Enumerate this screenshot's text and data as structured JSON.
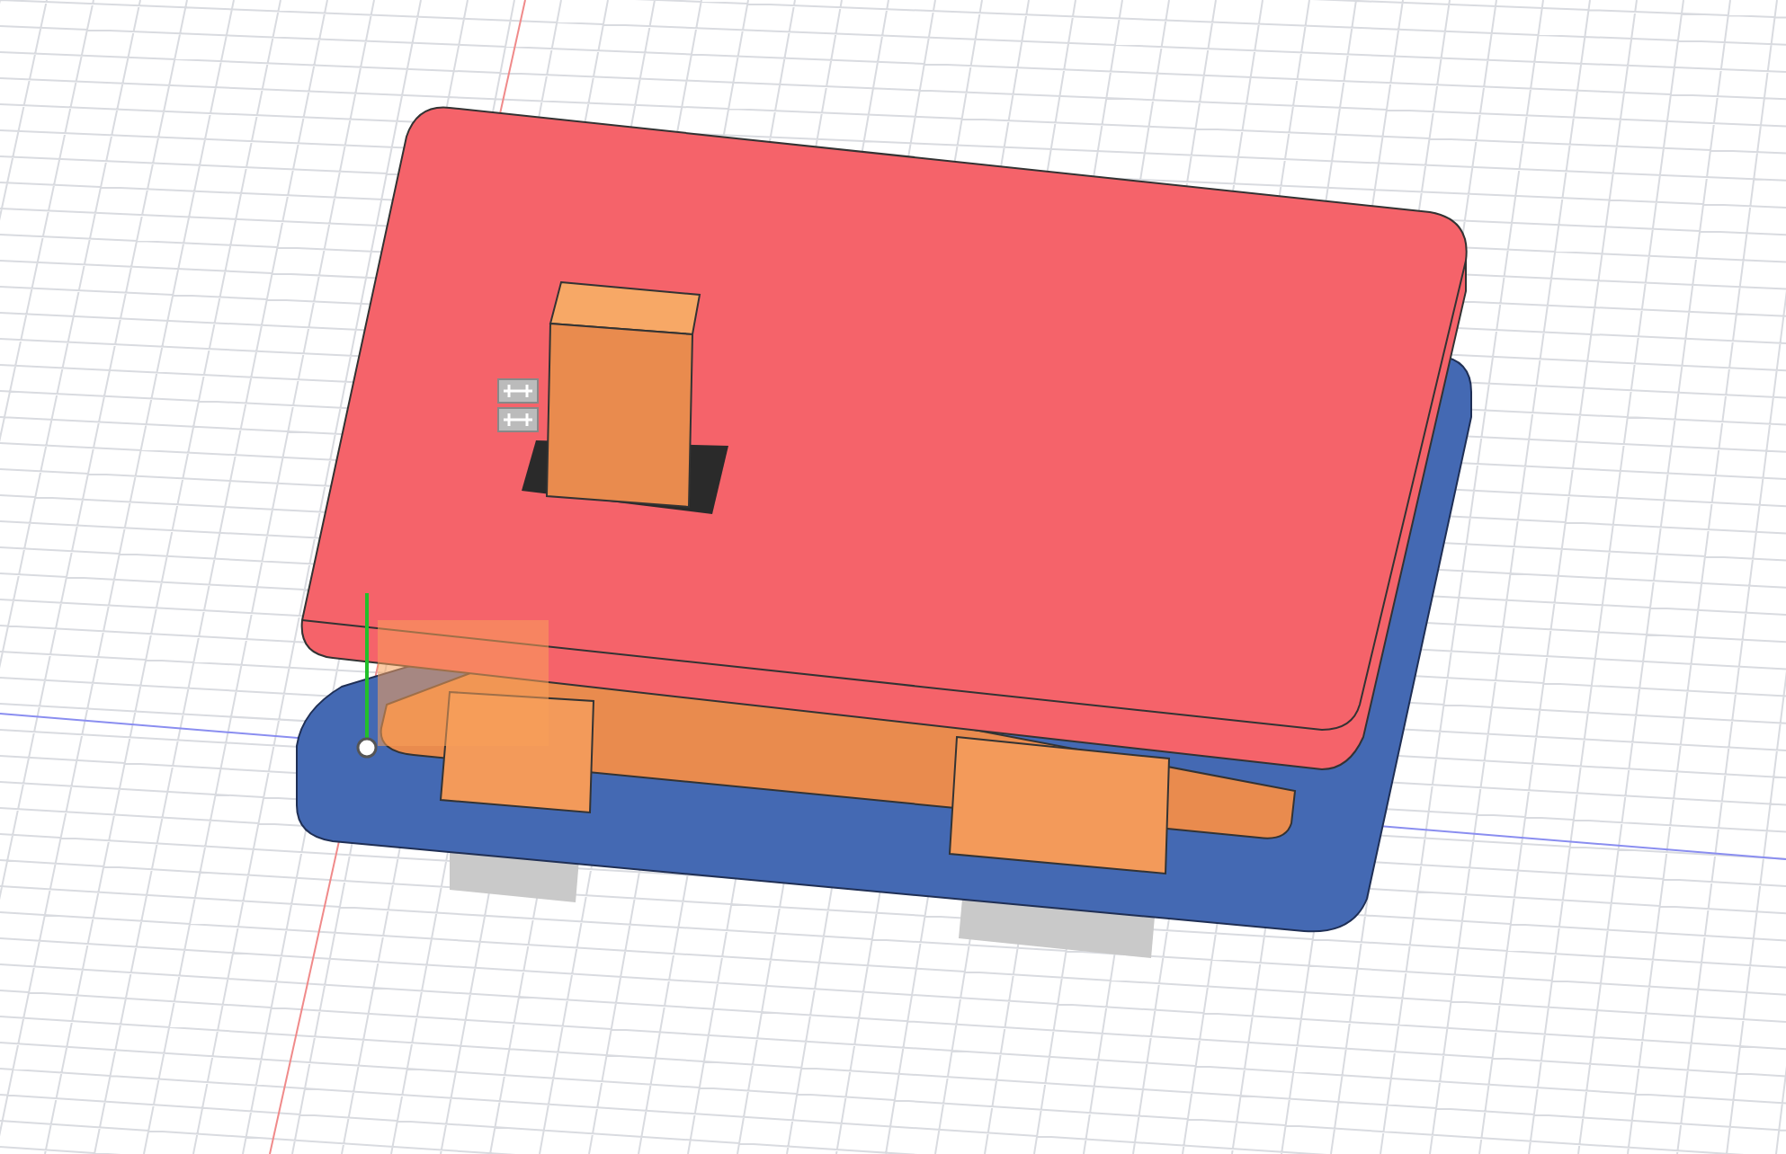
{
  "viewport": {
    "grid": true,
    "origin_axes": true
  }
}
